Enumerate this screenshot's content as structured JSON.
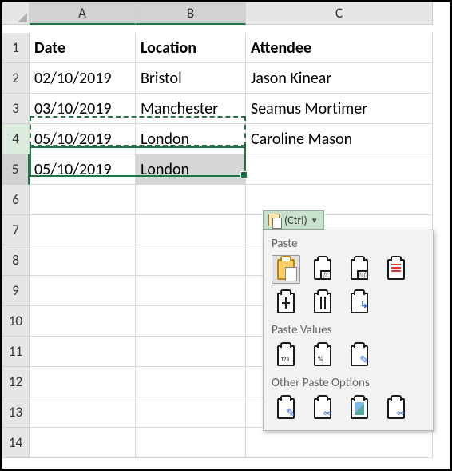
{
  "columns": {
    "A": "A",
    "B": "B",
    "C": "C"
  },
  "rows": {
    "r1": "1",
    "r2": "2",
    "r3": "3",
    "r4": "4",
    "r5": "5",
    "r6": "6",
    "r7": "7",
    "r8": "8",
    "r9": "9",
    "r10": "10",
    "r11": "11",
    "r12": "12",
    "r13": "13",
    "r14": "14"
  },
  "cells": {
    "A1": "Date",
    "B1": "Location",
    "C1": "Attendee",
    "A2": "02/10/2019",
    "B2": "Bristol",
    "C2": "Jason Kinear",
    "A3": "03/10/2019",
    "B3": "Manchester",
    "C3": "Seamus Mortimer",
    "A4": "05/10/2019",
    "B4": "London",
    "C4": "Caroline Mason",
    "A5": "05/10/2019",
    "B5": "London"
  },
  "ctrl_label": "(Ctrl) ",
  "popup": {
    "paste": "Paste",
    "paste_values": "Paste Values",
    "other": "Other Paste Options"
  }
}
